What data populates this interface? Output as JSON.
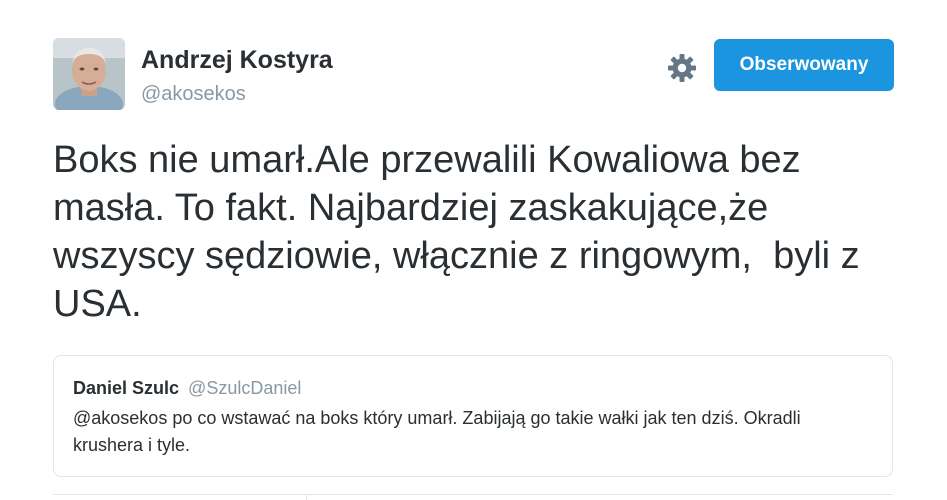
{
  "author": {
    "name": "Andrzej Kostyra",
    "handle": "@akosekos"
  },
  "follow_button": {
    "label": "Obserwowany",
    "color": "#1b95e0"
  },
  "settings_icon": "gear-icon",
  "tweet": {
    "text": "Boks nie umarł.Ale przewalili Kowaliowa bez masła. To fakt. Najbardziej zaskakujące,że wszyscy sędziowie, włącznie z ringowym,  byli z USA."
  },
  "quoted_tweet": {
    "name": "Daniel Szulc",
    "handle": "@SzulcDaniel",
    "text": "@akosekos po co wstawać na boks który umarł. Zabijają go takie wałki jak ten dziś. Okradli krushera i tyle."
  },
  "colors": {
    "text": "#292f33",
    "muted": "#8899a6",
    "border": "#e1e8ed"
  }
}
